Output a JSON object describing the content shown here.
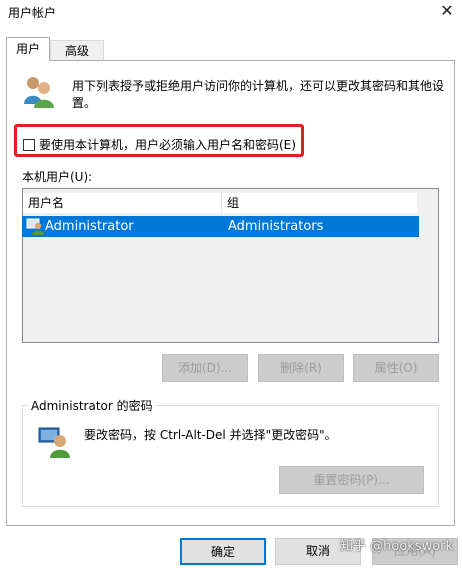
{
  "window": {
    "title": "用户帐户",
    "close_glyph": "✕"
  },
  "tabs": [
    {
      "label": "用户",
      "active": true
    },
    {
      "label": "高级",
      "active": false
    }
  ],
  "intro_text": "用下列表授予或拒绝用户访问你的计算机，还可以更改其密码和其他设置。",
  "require_login": {
    "label": "要使用本计算机，用户必须输入用户名和密码(E)",
    "checked": false
  },
  "local_users": {
    "label": "本机用户(U):",
    "columns": [
      "用户名",
      "组"
    ],
    "rows": [
      {
        "name": "Administrator",
        "group": "Administrators",
        "selected": true
      }
    ]
  },
  "user_buttons": {
    "add": "添加(D)...",
    "remove": "删除(R)",
    "properties": "属性(O)"
  },
  "password_group": {
    "title": "Administrator 的密码",
    "text": "要改密码，按 Ctrl-Alt-Del 并选择\"更改密码\"。",
    "reset_button": "重置密码(P)..."
  },
  "footer": {
    "ok": "确定",
    "cancel": "取消",
    "apply": "应用(A)"
  },
  "watermark": "知乎 @hookswork",
  "colors": {
    "accent": "#0078d7",
    "highlight_border": "#e0201f",
    "disabled_text": "#9c9c9c"
  },
  "icons": {
    "users": "users-icon",
    "user_row": "user-icon",
    "password": "user-password-icon"
  }
}
